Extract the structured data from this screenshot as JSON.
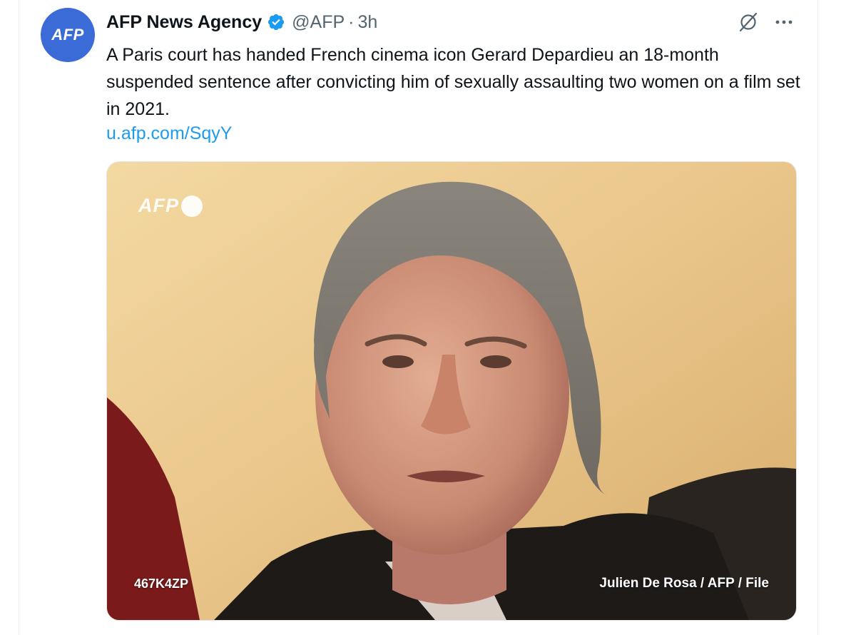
{
  "tweet": {
    "avatar_text": "AFP",
    "display_name": "AFP News Agency",
    "handle": "@AFP",
    "separator": "·",
    "time": "3h",
    "verified_icon": "verified-badge-icon",
    "text": "A Paris court has handed French cinema icon Gerard Depardieu an 18-month suspended sentence after convicting him of sexually assaulting two women on a film set in 2021.",
    "link": "u.afp.com/SqyY",
    "actions": {
      "grok_icon": "grok-icon",
      "more_icon": "more-icon"
    }
  },
  "media": {
    "watermark": "AFP",
    "code": "467K4ZP",
    "credit": "Julien De Rosa / AFP / File"
  },
  "colors": {
    "link": "#1d9bf0",
    "text": "#0f1419",
    "secondary": "#536471",
    "avatar_bg": "#3a6bd6",
    "verified": "#1d9bf0"
  }
}
